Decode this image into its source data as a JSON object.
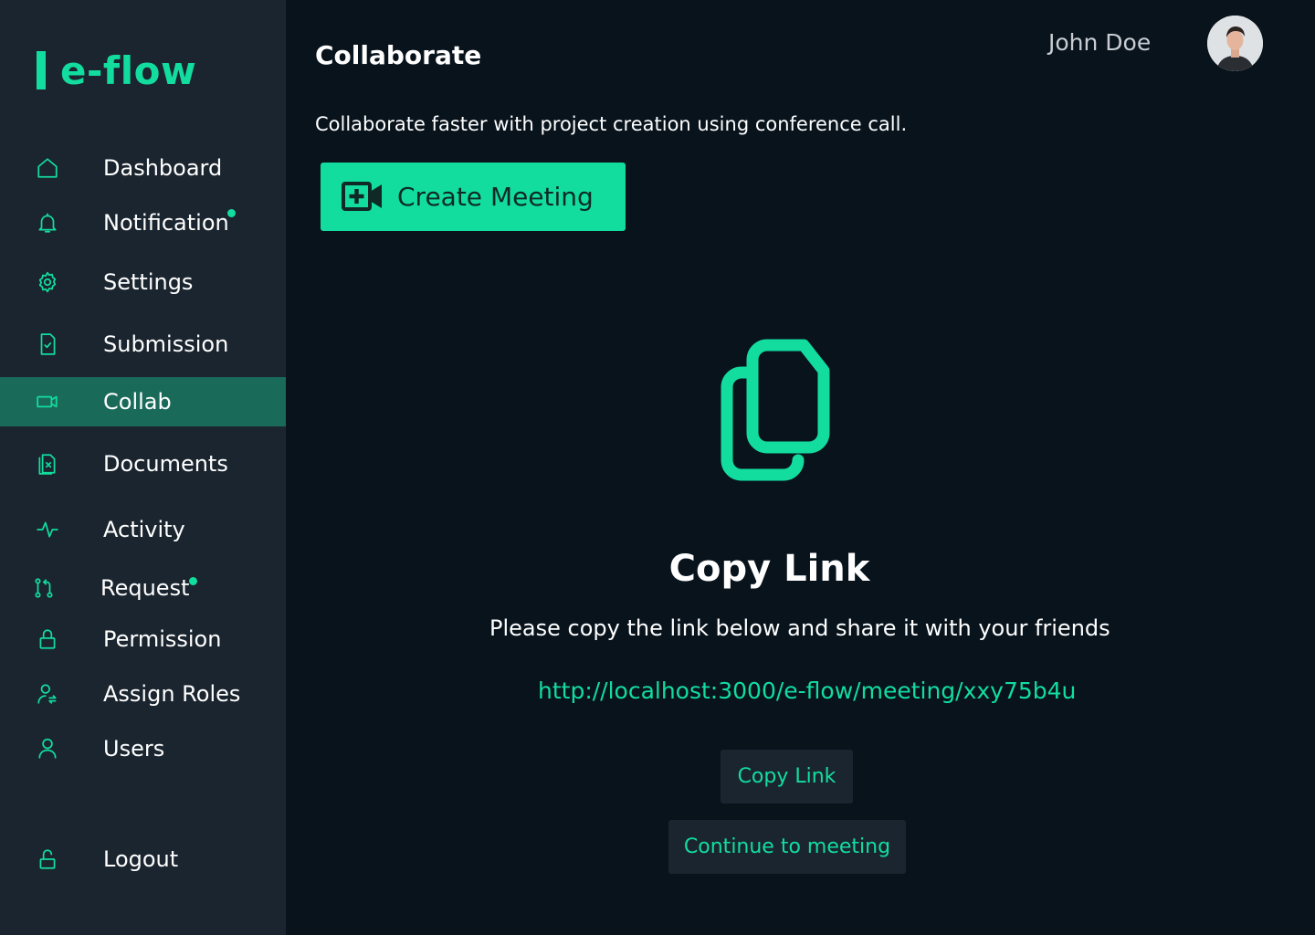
{
  "app": {
    "logo_text": "e-flow",
    "accent_color": "#12dd9f"
  },
  "sidebar": {
    "items": [
      {
        "label": "Dashboard",
        "icon": "home-icon"
      },
      {
        "label": "Notification",
        "icon": "bell-icon",
        "badge": true
      },
      {
        "label": "Settings",
        "icon": "gear-icon"
      },
      {
        "label": "Submission",
        "icon": "file-check-icon"
      },
      {
        "label": "Collab",
        "icon": "video-icon",
        "active": true
      },
      {
        "label": "Documents",
        "icon": "document-x-icon"
      },
      {
        "label": "Activity",
        "icon": "activity-icon"
      },
      {
        "label": "Request",
        "icon": "git-pull-request-icon",
        "badge": true
      },
      {
        "label": "Permission",
        "icon": "lock-icon"
      },
      {
        "label": "Assign Roles",
        "icon": "user-assign-icon"
      },
      {
        "label": "Users",
        "icon": "user-icon"
      }
    ],
    "logout": {
      "label": "Logout",
      "icon": "unlock-icon"
    }
  },
  "header": {
    "title": "Collaborate",
    "user_name": "John Doe"
  },
  "main": {
    "subtitle": "Collaborate faster with project creation using conference call.",
    "create_button": "Create Meeting",
    "copy_title": "Copy Link",
    "copy_description": "Please copy the link below and share it with your friends",
    "meeting_url": "http://localhost:3000/e-flow/meeting/xxy75b4u",
    "copy_button": "Copy Link",
    "continue_button": "Continue to meeting"
  }
}
